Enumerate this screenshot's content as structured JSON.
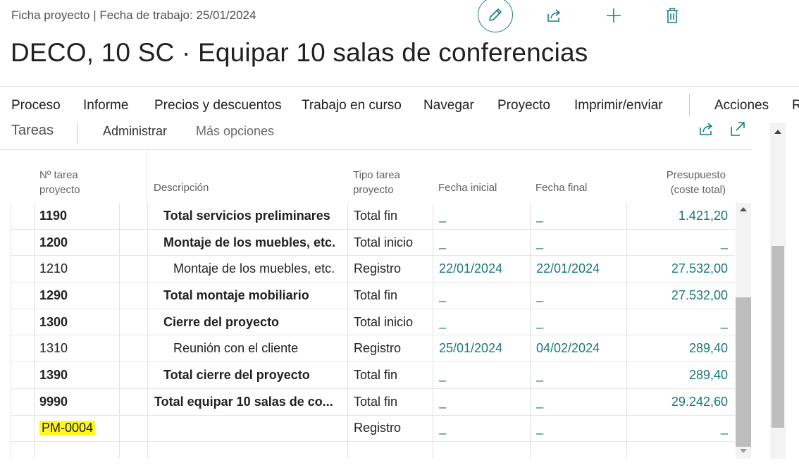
{
  "header": {
    "caption": "Ficha proyecto | Fecha de trabajo: 25/01/2024",
    "title": "DECO, 10 SC · Equipar 10 salas de conferencias"
  },
  "menu": {
    "items": [
      "Proceso",
      "Informe",
      "Precios y descuentos",
      "Trabajo en curso",
      "Navegar",
      "Proyecto",
      "Imprimir/enviar",
      "Acciones",
      "R"
    ]
  },
  "part": {
    "title": "Tareas",
    "tabs": [
      "Administrar",
      "Más opciones"
    ]
  },
  "columns": {
    "no": "Nº tarea proyecto",
    "desc": "Descripción",
    "type": "Tipo tarea proyecto",
    "start": "Fecha inicial",
    "end": "Fecha final",
    "budget": "Presupuesto (coste total)"
  },
  "rows": [
    {
      "no": "1190",
      "desc": "Total servicios preliminares",
      "type": "Total fin",
      "start": "_",
      "end": "_",
      "budget": "1.421,20",
      "bold": true,
      "indent": 0
    },
    {
      "no": "1200",
      "desc": "Montaje de los muebles, etc.",
      "type": "Total inicio",
      "start": "_",
      "end": "_",
      "budget": "_",
      "bold": true,
      "indent": 0
    },
    {
      "no": "1210",
      "desc": "Montaje de los muebles, etc.",
      "type": "Registro",
      "start": "22/01/2024",
      "end": "22/01/2024",
      "budget": "27.532,00",
      "bold": false,
      "indent": 1
    },
    {
      "no": "1290",
      "desc": "Total montaje mobiliario",
      "type": "Total fin",
      "start": "_",
      "end": "_",
      "budget": "27.532,00",
      "bold": true,
      "indent": 0
    },
    {
      "no": "1300",
      "desc": "Cierre del proyecto",
      "type": "Total inicio",
      "start": "_",
      "end": "_",
      "budget": "_",
      "bold": true,
      "indent": 0
    },
    {
      "no": "1310",
      "desc": "Reunión con el cliente",
      "type": "Registro",
      "start": "25/01/2024",
      "end": "04/02/2024",
      "budget": "289,40",
      "bold": false,
      "indent": 1
    },
    {
      "no": "1390",
      "desc": "Total cierre del proyecto",
      "type": "Total fin",
      "start": "_",
      "end": "_",
      "budget": "289,40",
      "bold": true,
      "indent": 0
    },
    {
      "no": "9990",
      "desc": "Total equipar 10 salas de co...",
      "type": "Total fin",
      "start": "_",
      "end": "_",
      "budget": "29.242,60",
      "bold": true,
      "indent": -1
    },
    {
      "no": "PM-0004",
      "desc": "",
      "type": "Registro",
      "start": "_",
      "end": "_",
      "budget": "_",
      "bold": false,
      "indent": 0,
      "highlight": true
    }
  ],
  "icons": {
    "edit": "pencil-icon",
    "share": "share-icon",
    "new": "plus-icon",
    "delete": "trash-icon",
    "part_share": "share-icon",
    "expand": "expand-icon"
  },
  "colors": {
    "accent": "#1b7a76",
    "highlight": "#fff820"
  }
}
